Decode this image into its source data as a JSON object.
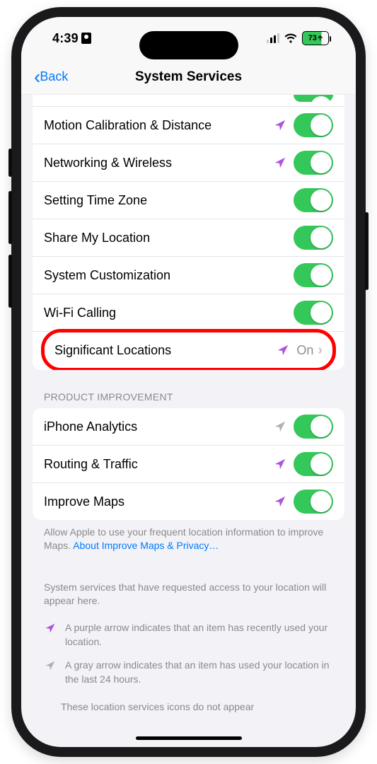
{
  "status": {
    "time": "4:39",
    "battery": "73"
  },
  "nav": {
    "back": "Back",
    "title": "System Services"
  },
  "group1": [
    {
      "label": "Motion Calibration & Distance",
      "arrow": "purple",
      "on": true
    },
    {
      "label": "Networking & Wireless",
      "arrow": "purple",
      "on": true
    },
    {
      "label": "Setting Time Zone",
      "arrow": null,
      "on": true
    },
    {
      "label": "Share My Location",
      "arrow": null,
      "on": true
    },
    {
      "label": "System Customization",
      "arrow": null,
      "on": true
    },
    {
      "label": "Wi-Fi Calling",
      "arrow": null,
      "on": true
    }
  ],
  "significant": {
    "label": "Significant Locations",
    "arrow": "purple",
    "value": "On"
  },
  "section2_header": "PRODUCT IMPROVEMENT",
  "group2": [
    {
      "label": "iPhone Analytics",
      "arrow": "gray",
      "on": true
    },
    {
      "label": "Routing & Traffic",
      "arrow": "purple",
      "on": true
    },
    {
      "label": "Improve Maps",
      "arrow": "purple",
      "on": true
    }
  ],
  "footer": {
    "text": "Allow Apple to use your frequent location information to improve Maps. ",
    "link": "About Improve Maps & Privacy…"
  },
  "legend": {
    "intro": "System services that have requested access to your location will appear here.",
    "purple": "A purple arrow indicates that an item has recently used your location.",
    "gray": "A gray arrow indicates that an item has used your location in the last 24 hours.",
    "last": "These location services icons do not appear"
  }
}
